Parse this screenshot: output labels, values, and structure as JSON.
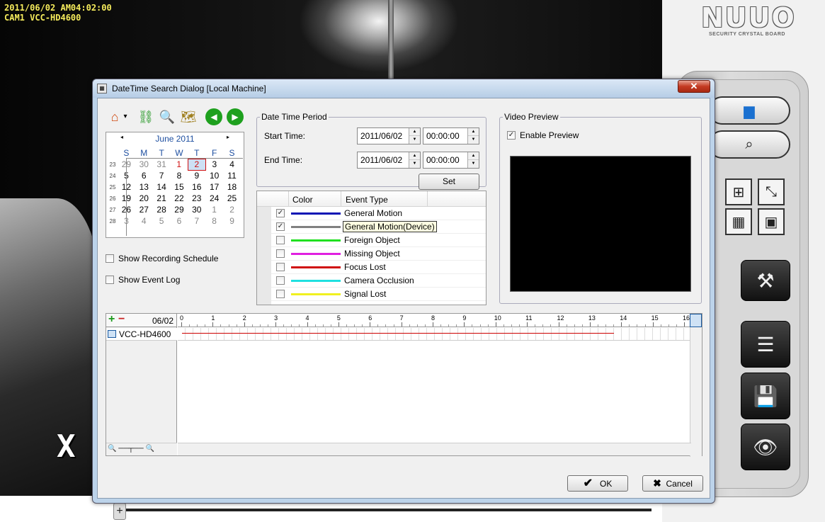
{
  "camera": {
    "osd_datetime": "2011/06/02 AM04:02:00",
    "osd_camera": "CAM1 VCC-HD4600",
    "overlay_glyph": "X"
  },
  "logo": {
    "brand": "NUUO",
    "tagline": "SECURITY CRYSTAL BOARD"
  },
  "dialog": {
    "title": "DateTime Search Dialog  [Local Machine]",
    "close_label": "✕",
    "toolbar": [
      {
        "name": "home-icon",
        "glyph": "⌂"
      },
      {
        "name": "dropdown-arrow-icon",
        "glyph": "▾"
      },
      {
        "name": "link-icon",
        "glyph": "⛓"
      },
      {
        "name": "search-server-icon",
        "glyph": "🔍"
      },
      {
        "name": "search-map-icon",
        "glyph": "🗺"
      },
      {
        "name": "previous-icon",
        "glyph": "◀"
      },
      {
        "name": "next-icon",
        "glyph": "▶"
      }
    ],
    "calendar": {
      "month_label": "June 2011",
      "prev": "◂",
      "next": "▸",
      "weekdays": [
        "S",
        "M",
        "T",
        "W",
        "T",
        "F",
        "S"
      ],
      "week_numbers": [
        "23",
        "24",
        "25",
        "26",
        "27",
        "28"
      ],
      "weeks": [
        [
          "29",
          "30",
          "31",
          "1",
          "2",
          "3",
          "4"
        ],
        [
          "5",
          "6",
          "7",
          "8",
          "9",
          "10",
          "11"
        ],
        [
          "12",
          "13",
          "14",
          "15",
          "16",
          "17",
          "18"
        ],
        [
          "19",
          "20",
          "21",
          "22",
          "23",
          "24",
          "25"
        ],
        [
          "26",
          "27",
          "28",
          "29",
          "30",
          "1",
          "2"
        ],
        [
          "3",
          "4",
          "5",
          "6",
          "7",
          "8",
          "9"
        ]
      ]
    },
    "show_recording_schedule": "Show Recording Schedule",
    "show_event_log": "Show Event Log",
    "date_time_period": {
      "legend": "Date Time Period",
      "start_label": "Start Time:",
      "start_date": "2011/06/02",
      "start_time": "00:00:00",
      "end_label": "End Time:",
      "end_date": "2011/06/02",
      "end_time": "00:00:00",
      "set_label": "Set"
    },
    "event_table": {
      "col_color": "Color",
      "col_type": "Event Type",
      "rows": [
        {
          "label": "General Motion",
          "color": "#0a14b4",
          "checked": true
        },
        {
          "label": "General Motion(Device)",
          "color": "#808080",
          "checked": true
        },
        {
          "label": "Foreign Object",
          "color": "#20e020",
          "checked": false
        },
        {
          "label": "Missing Object",
          "color": "#e020e0",
          "checked": false
        },
        {
          "label": "Focus Lost",
          "color": "#d01010",
          "checked": false
        },
        {
          "label": "Camera Occlusion",
          "color": "#20e0e0",
          "checked": false
        },
        {
          "label": "Signal Lost",
          "color": "#f0f020",
          "checked": false
        }
      ]
    },
    "video_preview": {
      "legend": "Video Preview",
      "enable_label": "Enable Preview",
      "enabled": true
    },
    "timeline": {
      "date": "06/02",
      "channel": "VCC-HD4600",
      "hours": [
        "0",
        "1",
        "2",
        "3",
        "4",
        "5",
        "6",
        "7",
        "8",
        "9",
        "10",
        "11",
        "12",
        "13",
        "14",
        "15",
        "16"
      ]
    },
    "ok_label": "OK",
    "cancel_label": "Cancel"
  }
}
